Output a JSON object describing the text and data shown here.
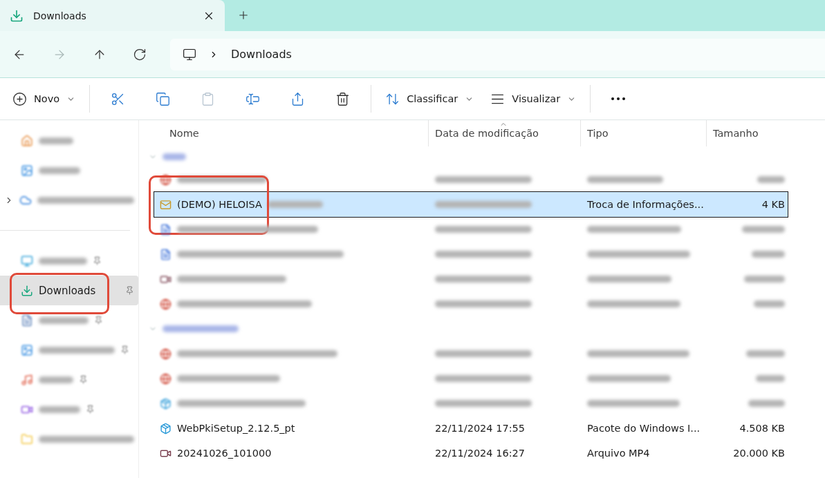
{
  "tab": {
    "title": "Downloads"
  },
  "nav": [
    {
      "kind": "back",
      "disabled": false
    },
    {
      "kind": "forward",
      "disabled": true
    },
    {
      "kind": "up",
      "disabled": false
    },
    {
      "kind": "refresh",
      "disabled": false
    }
  ],
  "breadcrumb": [
    "Downloads"
  ],
  "toolbar": [
    {
      "kind": "new",
      "label": "Novo",
      "disabled": false
    },
    {
      "kind": "cut",
      "disabled": false
    },
    {
      "kind": "copy",
      "disabled": false
    },
    {
      "kind": "paste",
      "disabled": true
    },
    {
      "kind": "rename",
      "disabled": false
    },
    {
      "kind": "share",
      "disabled": false
    },
    {
      "kind": "delete",
      "disabled": false
    },
    {
      "kind": "sort",
      "label": "Classificar",
      "disabled": false
    },
    {
      "kind": "view",
      "label": "Visualizar",
      "disabled": false
    },
    {
      "kind": "more",
      "disabled": false
    }
  ],
  "sidebar": {
    "groups": [
      [
        {
          "kind": "home",
          "selected": false,
          "pinned": false,
          "expandable": false,
          "highlight": false
        },
        {
          "kind": "gallery",
          "selected": false,
          "pinned": false,
          "expandable": false,
          "highlight": false
        },
        {
          "kind": "cloud",
          "selected": false,
          "pinned": false,
          "expandable": true,
          "highlight": false
        }
      ],
      [
        {
          "kind": "desktop",
          "selected": false,
          "pinned": true,
          "expandable": false,
          "highlight": false
        },
        {
          "kind": "downloads",
          "label": "Downloads",
          "selected": true,
          "pinned": true,
          "expandable": false,
          "highlight": true
        },
        {
          "kind": "documents",
          "selected": false,
          "pinned": true,
          "expandable": false,
          "highlight": false
        },
        {
          "kind": "pictures",
          "selected": false,
          "pinned": true,
          "expandable": false,
          "highlight": false
        },
        {
          "kind": "music",
          "selected": false,
          "pinned": true,
          "expandable": false,
          "highlight": false
        },
        {
          "kind": "videos",
          "selected": false,
          "pinned": true,
          "expandable": false,
          "highlight": false
        },
        {
          "kind": "folder",
          "selected": false,
          "pinned": false,
          "expandable": false,
          "highlight": false
        }
      ]
    ]
  },
  "table": {
    "columns": [
      "Nome",
      "Data de modificação",
      "Tipo",
      "Tamanho"
    ],
    "groups": [
      {
        "rows": [
          {
            "kind": "web",
            "selected": false,
            "highlight": false
          },
          {
            "kind": "mail",
            "name": "(DEMO) HELOISA",
            "type": "Troca de Informações...",
            "size": "4 KB",
            "selected": true,
            "highlight": true
          },
          {
            "kind": "doc",
            "selected": false,
            "highlight": false
          },
          {
            "kind": "doc",
            "selected": false,
            "highlight": false
          },
          {
            "kind": "video",
            "selected": false,
            "highlight": false
          },
          {
            "kind": "web",
            "selected": false,
            "highlight": false
          }
        ]
      },
      {
        "rows": [
          {
            "kind": "web",
            "selected": false,
            "highlight": false
          },
          {
            "kind": "web",
            "selected": false,
            "highlight": false
          },
          {
            "kind": "installer",
            "selected": false,
            "highlight": false
          },
          {
            "kind": "installer",
            "name": "WebPkiSetup_2.12.5_pt",
            "date": "22/11/2024 17:55",
            "type": "Pacote do Windows I...",
            "size": "4.508 KB",
            "selected": false,
            "highlight": false
          },
          {
            "kind": "video",
            "name": "20241026_101000",
            "date": "22/11/2024 16:27",
            "type": "Arquivo MP4",
            "size": "20.000 KB",
            "selected": false,
            "highlight": false
          }
        ]
      }
    ]
  }
}
